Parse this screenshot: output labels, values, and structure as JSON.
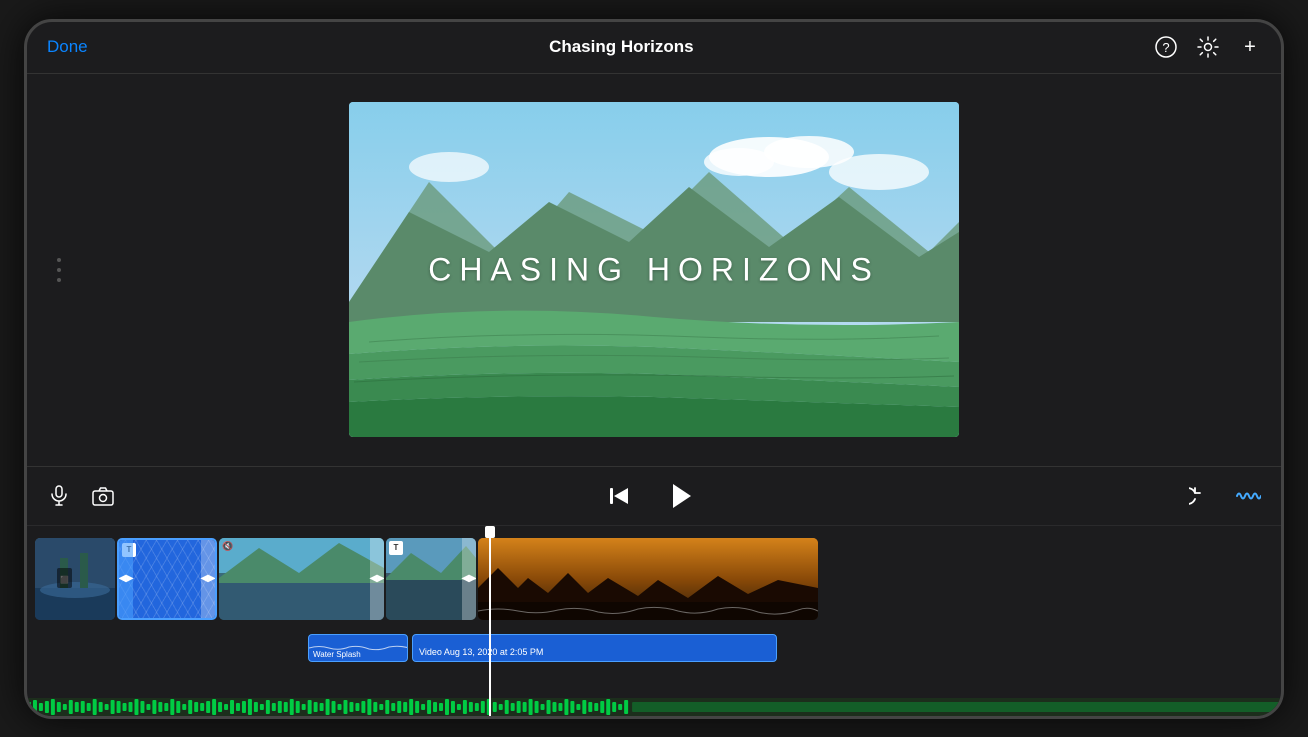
{
  "header": {
    "done_label": "Done",
    "title": "Chasing Horizons",
    "help_icon": "?",
    "settings_icon": "⚙",
    "add_icon": "+"
  },
  "preview": {
    "title_overlay": "CHASING HORIZONS"
  },
  "controls": {
    "mic_icon": "mic",
    "camera_icon": "camera",
    "skip_back_icon": "skip-back",
    "play_icon": "play",
    "undo_icon": "undo",
    "audio_wave_icon": "audio-wave"
  },
  "timeline": {
    "clips": [
      {
        "id": "clip1",
        "type": "video",
        "label": ""
      },
      {
        "id": "clip2",
        "type": "title",
        "label": "T"
      },
      {
        "id": "clip3",
        "type": "video",
        "label": ""
      },
      {
        "id": "clip4",
        "type": "title",
        "label": "T"
      },
      {
        "id": "clip5",
        "type": "video",
        "label": ""
      }
    ],
    "audio_clips": [
      {
        "id": "water_splash",
        "label": "Water Splash"
      },
      {
        "id": "video_aug",
        "label": "Video Aug 13, 2020 at 2:05 PM"
      }
    ]
  }
}
